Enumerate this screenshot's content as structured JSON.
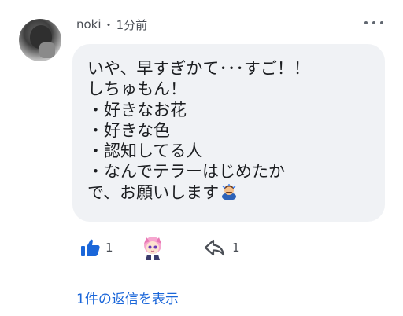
{
  "comment": {
    "author": "noki",
    "separator": "・",
    "timestamp": "1分前",
    "text": "いや、早すぎかて･･･すご！！\nしちゅもん！\n・好きなお花\n・好きな色\n・認知してる人\n・なんでテラーはじめたか\nで、お願いします",
    "emoji": "bowing-person-icon"
  },
  "actions": {
    "like_count": "1",
    "share_count": "1"
  },
  "replies": {
    "label": "1件の返信を表示"
  },
  "colors": {
    "bubble": "#f0f2f5",
    "accent": "#1a66d9",
    "meta": "#4b4f56"
  }
}
